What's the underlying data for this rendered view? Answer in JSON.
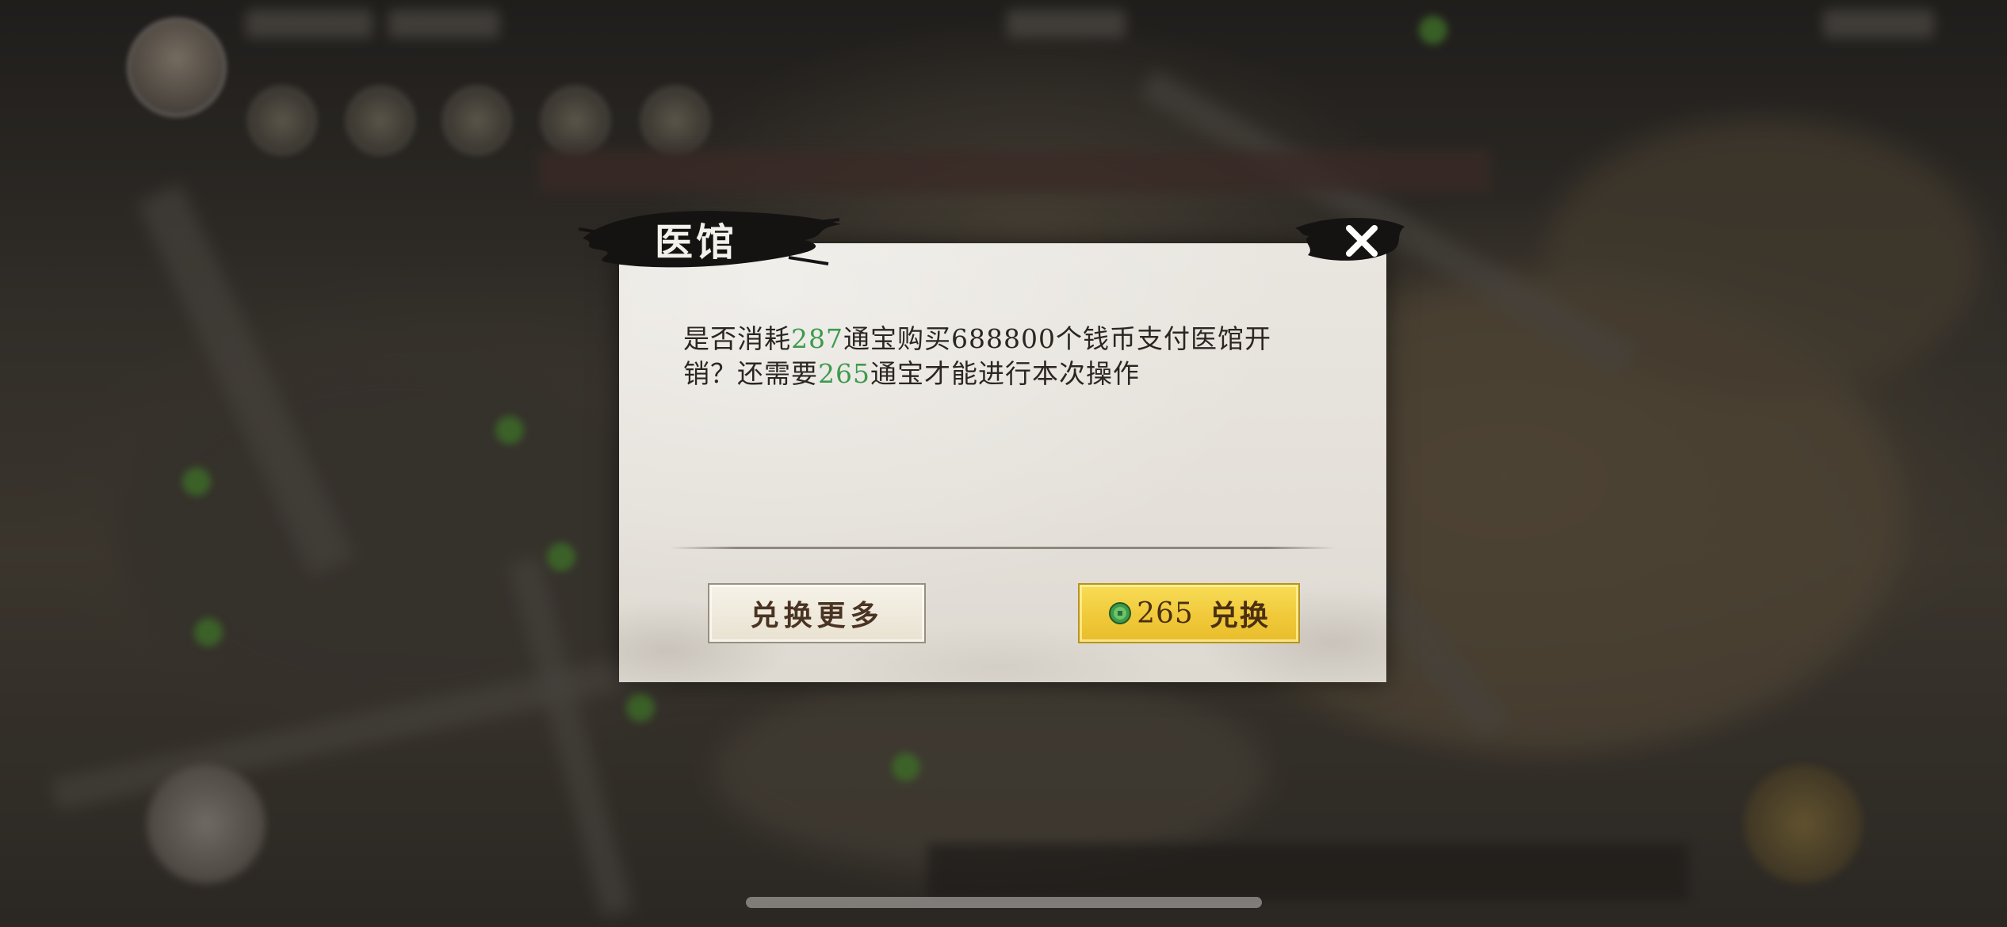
{
  "dialog": {
    "title": "医馆",
    "message": {
      "part1": "是否消耗",
      "cost1": "287",
      "part2": "通宝购买688800个钱币支付医馆开销？还需要",
      "cost2": "265",
      "part3": "通宝才能进行本次操作"
    },
    "highlight_color": "#3e9a4e",
    "buttons": {
      "more_label": "兑换更多",
      "exchange_cost": "265",
      "exchange_label": "兑换",
      "exchange_icon": "jade-coin-icon"
    },
    "close_icon": "close-icon"
  },
  "colors": {
    "exchange_button": "#f0c93a",
    "dialog_bg": "#e6e2db"
  }
}
